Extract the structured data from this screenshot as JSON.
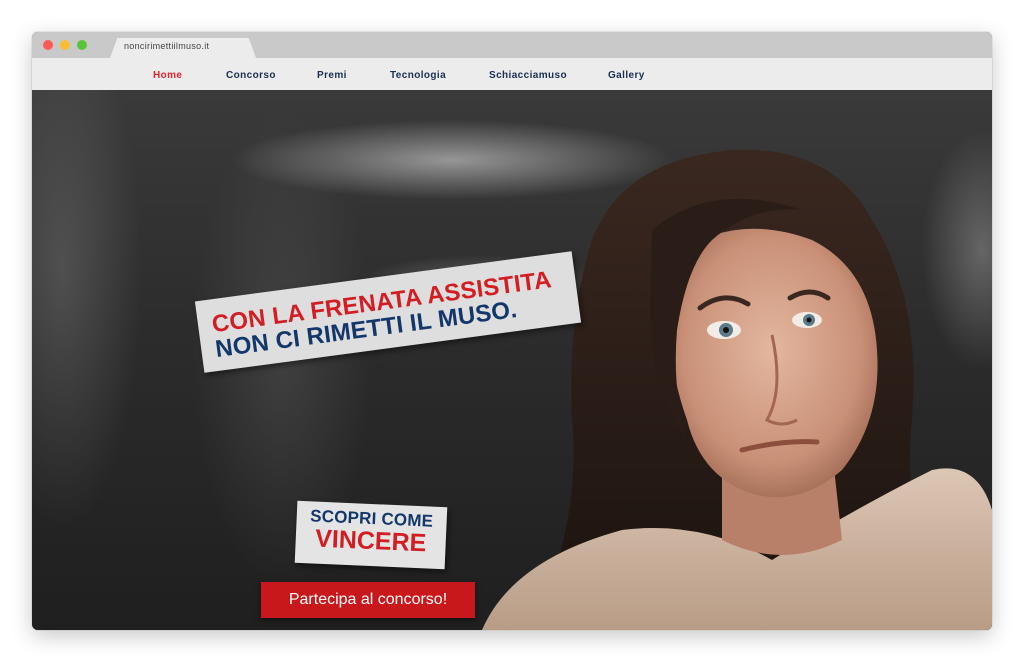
{
  "browser": {
    "tab_url": "noncirimettiilmuso.it"
  },
  "nav": {
    "items": [
      {
        "label": "Home",
        "active": true
      },
      {
        "label": "Concorso",
        "active": false
      },
      {
        "label": "Premi",
        "active": false
      },
      {
        "label": "Tecnologia",
        "active": false
      },
      {
        "label": "Schiacciamuso",
        "active": false
      },
      {
        "label": "Gallery",
        "active": false
      }
    ]
  },
  "hero": {
    "headline_line1": "CON LA FRENATA ASSISTITA",
    "headline_line2": "NON CI RIMETTI IL MUSO.",
    "promo_line1": "SCOPRI COME",
    "promo_line2": "VINCERE",
    "cta_label": "Partecipa al concorso!"
  },
  "colors": {
    "accent_red": "#d21d22",
    "navy": "#13376b",
    "nav_active": "#e0262b"
  }
}
